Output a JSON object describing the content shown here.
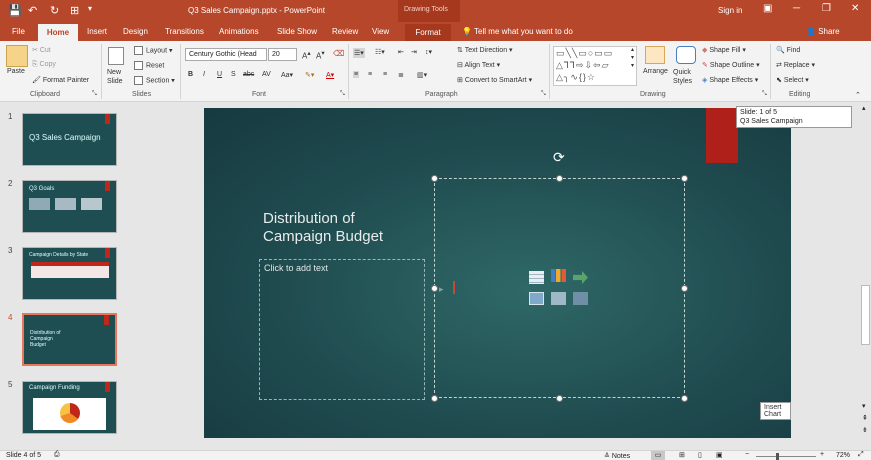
{
  "titlebar": {
    "title": "Q3 Sales Campaign.pptx - PowerPoint",
    "context_label": "Drawing Tools",
    "signin": "Sign in"
  },
  "tabs": [
    "File",
    "Home",
    "Insert",
    "Design",
    "Transitions",
    "Animations",
    "Slide Show",
    "Review",
    "View",
    "Format"
  ],
  "tellme": "Tell me what you want to do",
  "share": "Share",
  "ribbon": {
    "clipboard": {
      "paste": "Paste",
      "cut": "Cut",
      "copy": "Copy",
      "format_painter": "Format Painter",
      "label": "Clipboard"
    },
    "slides": {
      "new_slide": "New Slide",
      "layout": "Layout",
      "reset": "Reset",
      "section": "Section",
      "label": "Slides"
    },
    "font": {
      "font_name": "Century Gothic (Head",
      "font_size": "20",
      "label": "Font"
    },
    "paragraph": {
      "text_direction": "Text Direction",
      "align_text": "Align Text",
      "convert_smartart": "Convert to SmartArt",
      "label": "Paragraph"
    },
    "drawing": {
      "arrange": "Arrange",
      "quick_styles": "Quick Styles",
      "shape_fill": "Shape Fill",
      "shape_outline": "Shape Outline",
      "shape_effects": "Shape Effects",
      "label": "Drawing"
    },
    "editing": {
      "find": "Find",
      "replace": "Replace",
      "select": "Select",
      "label": "Editing"
    }
  },
  "thumbnails": [
    {
      "num": "1",
      "title": "Q3 Sales Campaign"
    },
    {
      "num": "2",
      "title": "Q3 Goals"
    },
    {
      "num": "3",
      "title": "Campaign Details by State"
    },
    {
      "num": "4",
      "title": "Distribution of Campaign Budget"
    },
    {
      "num": "5",
      "title": "Campaign Funding"
    }
  ],
  "slide": {
    "title": "Distribution of Campaign Budget",
    "placeholder": "Click to add text"
  },
  "tooltip": "Insert Chart",
  "slideinfo": {
    "line1": "Slide: 1 of 5",
    "line2": "Q3 Sales Campaign"
  },
  "statusbar": {
    "slide_count": "Slide 4 of 5",
    "notes": "Notes",
    "zoom": "72%"
  }
}
